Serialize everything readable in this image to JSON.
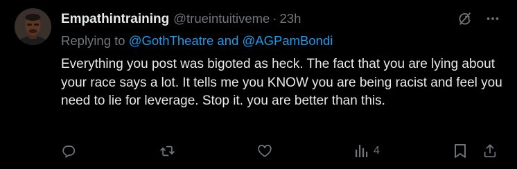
{
  "tweet": {
    "author_name": "Empathintraining",
    "handle": "@trueintuitiveme",
    "separator": "·",
    "time": "23h",
    "reply_prefix": "Replying to",
    "reply_mentions": "@GothTheatre and @AGPamBondi",
    "text": "Everything you post was bigoted as heck. The fact that you are lying about your race says a lot. It tells me you KNOW you are being racist and feel you need to lie for leverage. Stop it. you are better than this."
  },
  "actions": {
    "views_count": "4"
  },
  "icons": {
    "top": [
      "grok-icon",
      "more-icon"
    ],
    "bar": [
      "reply-icon",
      "retweet-icon",
      "like-icon",
      "views-icon",
      "bookmark-icon",
      "share-icon"
    ]
  },
  "colors": {
    "background": "#000000",
    "text": "#e7e9ea",
    "secondary": "#71767b",
    "link": "#1d9bf0"
  }
}
